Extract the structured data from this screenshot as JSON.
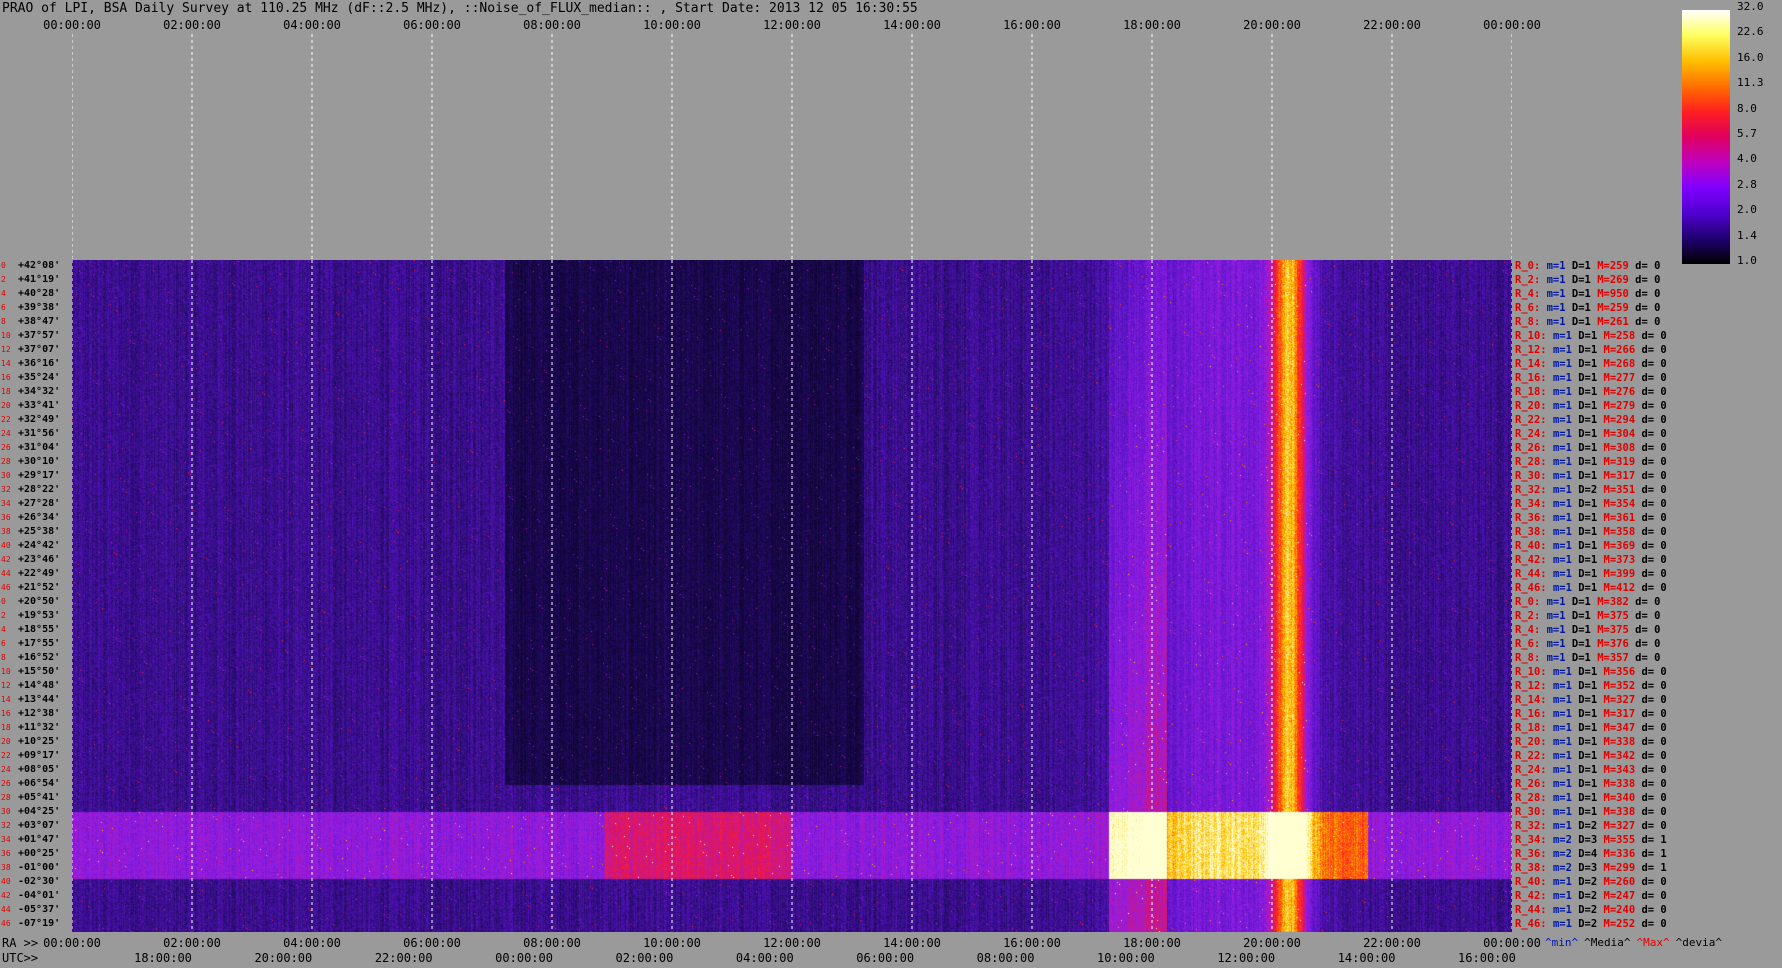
{
  "title": "PRAO of LPI, BSA Daily Survey at 110.25 MHz (dF::2.5 MHz), ::Noise_of_FLUX_median:: , Start Date: 2013 12 05 16:30:55",
  "chart_data": {
    "type": "heatmap",
    "title": "PRAO of LPI, BSA Daily Survey at 110.25 MHz (dF::2.5 MHz), ::Noise_of_FLUX_median:: , Start Date: 2013 12 05 16:30:55",
    "x_top_ticks": [
      "00:00:00",
      "02:00:00",
      "04:00:00",
      "06:00:00",
      "08:00:00",
      "10:00:00",
      "12:00:00",
      "14:00:00",
      "16:00:00",
      "18:00:00",
      "20:00:00",
      "22:00:00",
      "00:00:00"
    ],
    "x_ra_label": "RA >>",
    "x_ra_ticks": [
      "00:00:00",
      "02:00:00",
      "04:00:00",
      "06:00:00",
      "08:00:00",
      "10:00:00",
      "12:00:00",
      "14:00:00",
      "16:00:00",
      "18:00:00",
      "20:00:00",
      "22:00:00",
      "00:00:00"
    ],
    "x_utc_label": "UTC>>",
    "x_utc_ticks": [
      "18:00:00",
      "20:00:00",
      "22:00:00",
      "00:00:00",
      "02:00:00",
      "04:00:00",
      "06:00:00",
      "08:00:00",
      "10:00:00",
      "12:00:00",
      "14:00:00",
      "16:00:00"
    ],
    "y_declinations": [
      "+42°08'",
      "+41°19'",
      "+40°28'",
      "+39°38'",
      "+38°47'",
      "+37°57'",
      "+37°07'",
      "+36°16'",
      "+35°24'",
      "+34°32'",
      "+33°41'",
      "+32°49'",
      "+31°56'",
      "+31°04'",
      "+30°10'",
      "+29°17'",
      "+28°22'",
      "+27°28'",
      "+26°34'",
      "+25°38'",
      "+24°42'",
      "+23°46'",
      "+22°49'",
      "+21°52'",
      "+20°50'",
      "+19°53'",
      "+18°55'",
      "+17°55'",
      "+16°52'",
      "+15°50'",
      "+14°48'",
      "+13°44'",
      "+12°38'",
      "+11°32'",
      "+10°25'",
      "+09°17'",
      "+08°05'",
      "+06°54'",
      "+05°41'",
      "+04°25'",
      "+03°07'",
      "+01°47'",
      "+00°25'",
      "-01°00'",
      "-02°30'",
      "-04°01'",
      "-05°37'",
      "-07°19'"
    ],
    "y_beam_numbers": [
      "0",
      "2",
      "4",
      "6",
      "8",
      "10",
      "12",
      "14",
      "16",
      "18",
      "20",
      "22",
      "24",
      "26",
      "28",
      "30",
      "32",
      "34",
      "36",
      "38",
      "40",
      "42",
      "44",
      "46",
      "0",
      "2",
      "4",
      "6",
      "8",
      "10",
      "12",
      "14",
      "16",
      "18",
      "20",
      "22",
      "24",
      "26",
      "28",
      "30",
      "32",
      "34",
      "36",
      "38",
      "40",
      "42",
      "44",
      "46"
    ],
    "colorbar": {
      "ticks": [
        "32.0",
        "22.6",
        "16.0",
        "11.3",
        "8.0",
        "5.7",
        "4.0",
        "2.8",
        "2.0",
        "1.4",
        "1.0"
      ],
      "colors": [
        "#ffffff",
        "#ffff60",
        "#ffc000",
        "#ff7000",
        "#ff2020",
        "#e00060",
        "#c000c0",
        "#8000ff",
        "#5000d0",
        "#200070",
        "#000000"
      ]
    },
    "legend_keys": [
      {
        "text": "^min^",
        "color": "#0018a0"
      },
      {
        "text": "^Media^",
        "color": "#000000"
      },
      {
        "text": "^Max^",
        "color": "#e00000"
      },
      {
        "text": "^devia^",
        "color": "#000000"
      }
    ],
    "right_rows": [
      {
        "r": "R_0:",
        "m": "m=1",
        "D": "D=1",
        "M": "M=259",
        "d": "d= 0"
      },
      {
        "r": "R_2:",
        "m": "m=1",
        "D": "D=1",
        "M": "M=269",
        "d": "d= 0"
      },
      {
        "r": "R_4:",
        "m": "m=1",
        "D": "D=1",
        "M": "M=950",
        "d": "d= 0"
      },
      {
        "r": "R_6:",
        "m": "m=1",
        "D": "D=1",
        "M": "M=259",
        "d": "d= 0"
      },
      {
        "r": "R_8:",
        "m": "m=1",
        "D": "D=1",
        "M": "M=261",
        "d": "d= 0"
      },
      {
        "r": "R_10:",
        "m": "m=1",
        "D": "D=1",
        "M": "M=258",
        "d": "d= 0"
      },
      {
        "r": "R_12:",
        "m": "m=1",
        "D": "D=1",
        "M": "M=266",
        "d": "d= 0"
      },
      {
        "r": "R_14:",
        "m": "m=1",
        "D": "D=1",
        "M": "M=268",
        "d": "d= 0"
      },
      {
        "r": "R_16:",
        "m": "m=1",
        "D": "D=1",
        "M": "M=277",
        "d": "d= 0"
      },
      {
        "r": "R_18:",
        "m": "m=1",
        "D": "D=1",
        "M": "M=276",
        "d": "d= 0"
      },
      {
        "r": "R_20:",
        "m": "m=1",
        "D": "D=1",
        "M": "M=279",
        "d": "d= 0"
      },
      {
        "r": "R_22:",
        "m": "m=1",
        "D": "D=1",
        "M": "M=294",
        "d": "d= 0"
      },
      {
        "r": "R_24:",
        "m": "m=1",
        "D": "D=1",
        "M": "M=304",
        "d": "d= 0"
      },
      {
        "r": "R_26:",
        "m": "m=1",
        "D": "D=1",
        "M": "M=308",
        "d": "d= 0"
      },
      {
        "r": "R_28:",
        "m": "m=1",
        "D": "D=1",
        "M": "M=319",
        "d": "d= 0"
      },
      {
        "r": "R_30:",
        "m": "m=1",
        "D": "D=1",
        "M": "M=317",
        "d": "d= 0"
      },
      {
        "r": "R_32:",
        "m": "m=1",
        "D": "D=2",
        "M": "M=351",
        "d": "d= 0"
      },
      {
        "r": "R_34:",
        "m": "m=1",
        "D": "D=1",
        "M": "M=354",
        "d": "d= 0"
      },
      {
        "r": "R_36:",
        "m": "m=1",
        "D": "D=1",
        "M": "M=361",
        "d": "d= 0"
      },
      {
        "r": "R_38:",
        "m": "m=1",
        "D": "D=1",
        "M": "M=358",
        "d": "d= 0"
      },
      {
        "r": "R_40:",
        "m": "m=1",
        "D": "D=1",
        "M": "M=369",
        "d": "d= 0"
      },
      {
        "r": "R_42:",
        "m": "m=1",
        "D": "D=1",
        "M": "M=373",
        "d": "d= 0"
      },
      {
        "r": "R_44:",
        "m": "m=1",
        "D": "D=1",
        "M": "M=399",
        "d": "d= 0"
      },
      {
        "r": "R_46:",
        "m": "m=1",
        "D": "D=1",
        "M": "M=412",
        "d": "d= 0"
      },
      {
        "r": "R_0:",
        "m": "m=1",
        "D": "D=1",
        "M": "M=382",
        "d": "d= 0"
      },
      {
        "r": "R_2:",
        "m": "m=1",
        "D": "D=1",
        "M": "M=375",
        "d": "d= 0"
      },
      {
        "r": "R_4:",
        "m": "m=1",
        "D": "D=1",
        "M": "M=375",
        "d": "d= 0"
      },
      {
        "r": "R_6:",
        "m": "m=1",
        "D": "D=1",
        "M": "M=376",
        "d": "d= 0"
      },
      {
        "r": "R_8:",
        "m": "m=1",
        "D": "D=1",
        "M": "M=357",
        "d": "d= 0"
      },
      {
        "r": "R_10:",
        "m": "m=1",
        "D": "D=1",
        "M": "M=356",
        "d": "d= 0"
      },
      {
        "r": "R_12:",
        "m": "m=1",
        "D": "D=1",
        "M": "M=352",
        "d": "d= 0"
      },
      {
        "r": "R_14:",
        "m": "m=1",
        "D": "D=1",
        "M": "M=327",
        "d": "d= 0"
      },
      {
        "r": "R_16:",
        "m": "m=1",
        "D": "D=1",
        "M": "M=317",
        "d": "d= 0"
      },
      {
        "r": "R_18:",
        "m": "m=1",
        "D": "D=1",
        "M": "M=347",
        "d": "d= 0"
      },
      {
        "r": "R_20:",
        "m": "m=1",
        "D": "D=1",
        "M": "M=338",
        "d": "d= 0"
      },
      {
        "r": "R_22:",
        "m": "m=1",
        "D": "D=1",
        "M": "M=342",
        "d": "d= 0"
      },
      {
        "r": "R_24:",
        "m": "m=1",
        "D": "D=1",
        "M": "M=343",
        "d": "d= 0"
      },
      {
        "r": "R_26:",
        "m": "m=1",
        "D": "D=1",
        "M": "M=338",
        "d": "d= 0"
      },
      {
        "r": "R_28:",
        "m": "m=1",
        "D": "D=1",
        "M": "M=340",
        "d": "d= 0"
      },
      {
        "r": "R_30:",
        "m": "m=1",
        "D": "D=1",
        "M": "M=338",
        "d": "d= 0"
      },
      {
        "r": "R_32:",
        "m": "m=1",
        "D": "D=2",
        "M": "M=327",
        "d": "d= 0"
      },
      {
        "r": "R_34:",
        "m": "m=2",
        "D": "D=3",
        "M": "M=355",
        "d": "d= 1"
      },
      {
        "r": "R_36:",
        "m": "m=2",
        "D": "D=4",
        "M": "M=336",
        "d": "d= 1"
      },
      {
        "r": "R_38:",
        "m": "m=2",
        "D": "D=3",
        "M": "M=299",
        "d": "d= 1"
      },
      {
        "r": "R_40:",
        "m": "m=1",
        "D": "D=2",
        "M": "M=260",
        "d": "d= 0"
      },
      {
        "r": "R_42:",
        "m": "m=1",
        "D": "D=2",
        "M": "M=247",
        "d": "d= 0"
      },
      {
        "r": "R_44:",
        "m": "m=1",
        "D": "D=2",
        "M": "M=240",
        "d": "d= 0"
      },
      {
        "r": "R_46:",
        "m": "m=1",
        "D": "D=2",
        "M": "M=252",
        "d": "d= 0"
      }
    ]
  }
}
